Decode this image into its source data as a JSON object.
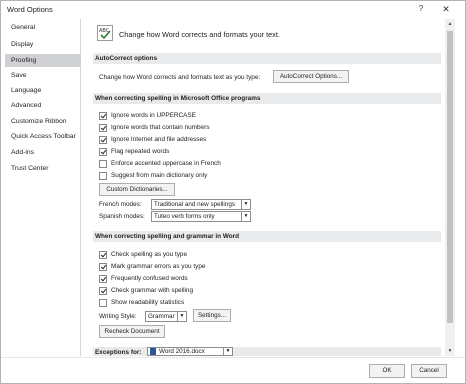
{
  "window": {
    "title": "Word Options",
    "help_label": "?",
    "close_label": "✕"
  },
  "nav": {
    "items": [
      {
        "label": "General"
      },
      {
        "label": "Display"
      },
      {
        "label": "Proofing"
      },
      {
        "label": "Save"
      },
      {
        "label": "Language"
      },
      {
        "label": "Advanced"
      },
      {
        "label": "Customize Ribbon"
      },
      {
        "label": "Quick Access Toolbar"
      },
      {
        "label": "Add-ins"
      },
      {
        "label": "Trust Center"
      }
    ],
    "selected": "Proofing"
  },
  "header": {
    "icon": "abc-spellcheck-icon",
    "text": "Change how Word corrects and formats your text."
  },
  "autocorrect": {
    "section_title": "AutoCorrect options",
    "description": "Change how Word corrects and formats text as you type:",
    "button_label": "AutoCorrect Options..."
  },
  "office_spelling": {
    "section_title": "When correcting spelling in Microsoft Office programs",
    "options": [
      {
        "label": "Ignore words in UPPERCASE",
        "checked": true
      },
      {
        "label": "Ignore words that contain numbers",
        "checked": true
      },
      {
        "label": "Ignore Internet and file addresses",
        "checked": true
      },
      {
        "label": "Flag repeated words",
        "checked": true
      },
      {
        "label": "Enforce accented uppercase in French",
        "checked": false
      },
      {
        "label": "Suggest from main dictionary only",
        "checked": false
      }
    ],
    "custom_dictionaries_label": "Custom Dictionaries...",
    "french_modes_label": "French modes:",
    "french_modes_value": "Traditional and new spellings",
    "spanish_modes_label": "Spanish modes:",
    "spanish_modes_value": "Tuteo verb forms only"
  },
  "word_spelling": {
    "section_title": "When correcting spelling and grammar in Word",
    "options": [
      {
        "label": "Check spelling as you type",
        "checked": true
      },
      {
        "label": "Mark grammar errors as you type",
        "checked": true
      },
      {
        "label": "Frequently confused words",
        "checked": true
      },
      {
        "label": "Check grammar with spelling",
        "checked": true
      },
      {
        "label": "Show readability statistics",
        "checked": false
      }
    ],
    "writing_style_label": "Writing Style:",
    "writing_style_value": "Grammar",
    "settings_label": "Settings...",
    "recheck_label": "Recheck Document"
  },
  "exceptions": {
    "label": "Exceptions for:",
    "document": "Word 2016.docx"
  },
  "footer": {
    "ok_label": "OK",
    "cancel_label": "Cancel"
  }
}
